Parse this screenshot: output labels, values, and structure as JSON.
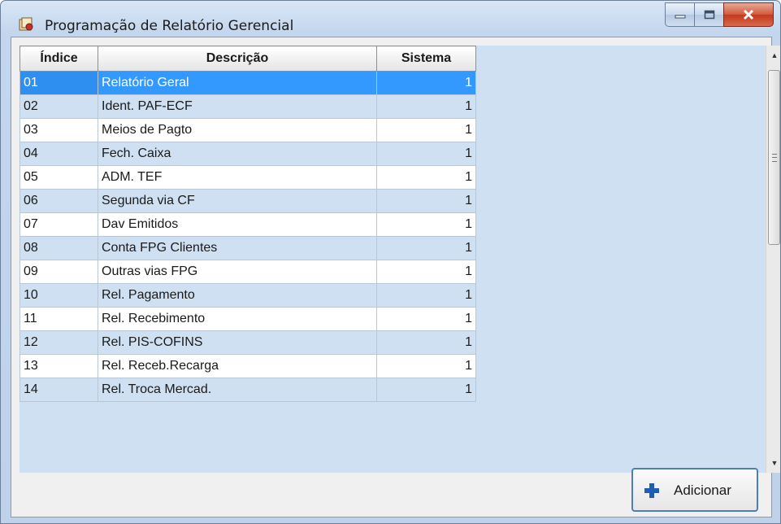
{
  "window": {
    "title": "Programação de Relatório Gerencial",
    "icons": {
      "app": "report-app-icon",
      "minimize": "minimize-icon",
      "maximize": "maximize-icon",
      "close": "close-icon"
    }
  },
  "grid": {
    "columns": [
      "Índice",
      "Descrição",
      "Sistema"
    ],
    "selected_index": "01",
    "rows": [
      {
        "indice": "01",
        "descricao": "Relatório Geral",
        "sistema": "1"
      },
      {
        "indice": "02",
        "descricao": "Ident. PAF-ECF",
        "sistema": "1"
      },
      {
        "indice": "03",
        "descricao": "Meios de Pagto",
        "sistema": "1"
      },
      {
        "indice": "04",
        "descricao": "Fech. Caixa",
        "sistema": "1"
      },
      {
        "indice": "05",
        "descricao": "ADM. TEF",
        "sistema": "1"
      },
      {
        "indice": "06",
        "descricao": "Segunda via CF",
        "sistema": "1"
      },
      {
        "indice": "07",
        "descricao": "Dav Emitidos",
        "sistema": "1"
      },
      {
        "indice": "08",
        "descricao": "Conta FPG Clientes",
        "sistema": "1"
      },
      {
        "indice": "09",
        "descricao": "Outras vias FPG",
        "sistema": "1"
      },
      {
        "indice": "10",
        "descricao": "Rel. Pagamento",
        "sistema": "1"
      },
      {
        "indice": "11",
        "descricao": "Rel. Recebimento",
        "sistema": "1"
      },
      {
        "indice": "12",
        "descricao": "Rel. PIS-COFINS",
        "sistema": "1"
      },
      {
        "indice": "13",
        "descricao": "Rel. Receb.Recarga",
        "sistema": "1"
      },
      {
        "indice": "14",
        "descricao": "Rel. Troca Mercad.",
        "sistema": "1"
      }
    ]
  },
  "scrollbar": {
    "up_icon": "scroll-up-icon",
    "down_icon": "scroll-down-icon"
  },
  "actions": {
    "add_label": "Adicionar",
    "add_icon": "plus-icon"
  },
  "colors": {
    "selection": "#3399ff",
    "alt_row": "#cfe0f2",
    "close_button": "#c23a1c"
  }
}
